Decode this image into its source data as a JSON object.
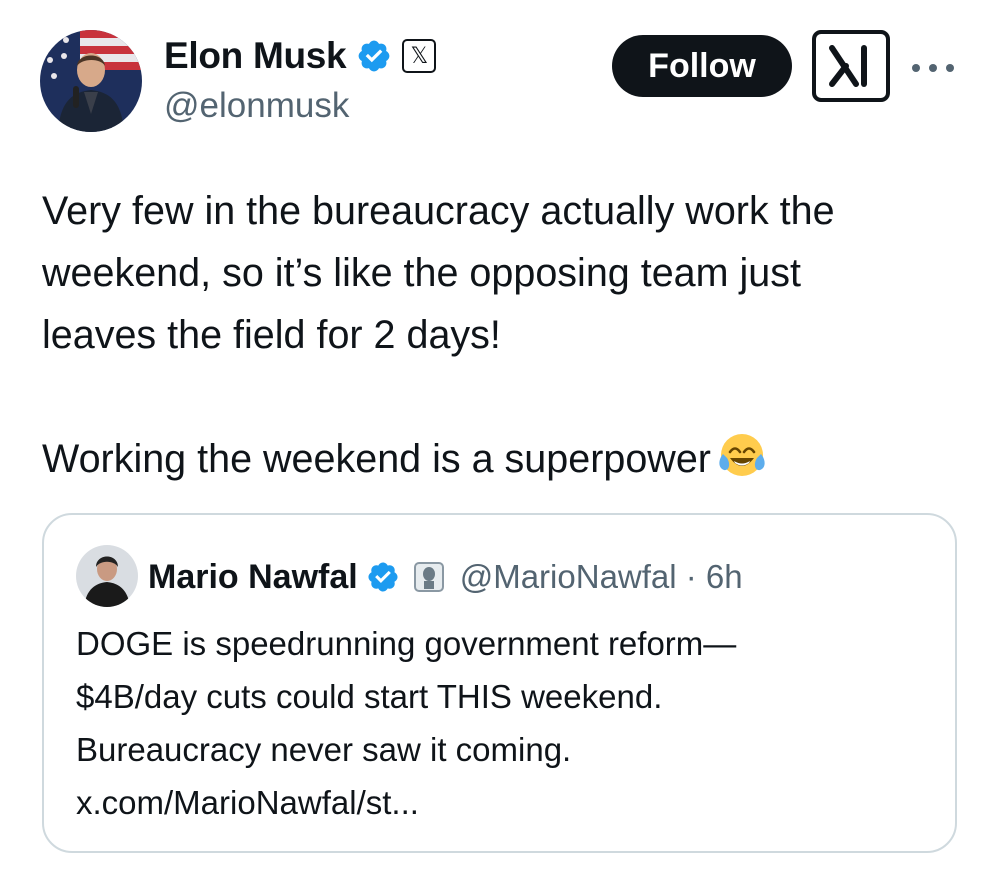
{
  "author": {
    "display_name": "Elon Musk",
    "handle": "@elonmusk",
    "affiliation_badge": "𝕏",
    "avatar_icon": "profile-photo-icon",
    "verified_color": "#1d9bf0"
  },
  "header": {
    "follow_label": "Follow",
    "grok_icon": "grok-icon",
    "more_icon": "more-options-icon"
  },
  "tweet": {
    "line1": "Very few in the bureaucracy actually work the",
    "line2": "weekend, so it’s like the opposing team just",
    "line3": "leaves the field for 2 days!",
    "line4": "Working the weekend is a superpower",
    "emoji": "face-with-tears-of-joy-icon"
  },
  "quote": {
    "display_name": "Mario Nawfal",
    "handle_time": "@MarioNawfal · 6h",
    "text_line1": "DOGE is speedrunning government reform—",
    "text_line2": "$4B/day cuts could start THIS weekend.",
    "text_line3": "Bureaucracy never saw it coming.",
    "text_line4": "x.com/MarioNawfal/st..."
  },
  "colors": {
    "text_primary": "#0f1419",
    "text_secondary": "#536471",
    "border": "#cfd9de",
    "follow_bg": "#0f1419"
  }
}
